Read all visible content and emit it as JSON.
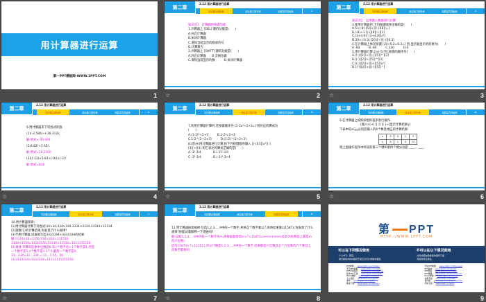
{
  "colors": {
    "accent": "#1ea0e6",
    "highlight": "#ffd400",
    "answer": "#e020e0",
    "logo_blue": "#1d4d8a",
    "logo_orange": "#f07a1a"
  },
  "header": {
    "chapter": "第二章",
    "section": "2.12  用计算器进行运算",
    "tabs": [
      "知识要点基础练",
      "综合能力提升练",
      "拓展探究突破练"
    ]
  },
  "slides": [
    {
      "number": "1",
      "type": "title",
      "title": "用计算器进行运算",
      "subtitle": "第一PPT模板网-WWW.1PPT.COM"
    },
    {
      "number": "2",
      "type": "content",
      "active_tab": 0,
      "page": "-2-",
      "lines": [
        {
          "t": "知识点1　计算器的按键功能",
          "c": "pink"
        },
        {
          "t": "1.计算器上 [DEL] 键的功能是(　　)"
        },
        {
          "t": "A.开启计算器"
        },
        {
          "t": "B.关闭计算器"
        },
        {
          "t": "C.清除当前显示的数或符号"
        },
        {
          "t": "D.计算乘方"
        },
        {
          "t": "2.计算器上 [SHIFT] 键的功能是(　　)"
        },
        {
          "t": "A.开启计算器　　B.交换功能"
        },
        {
          "t": "C.清除当前显示的数　　　D.关闭计算器"
        }
      ]
    },
    {
      "number": "3",
      "type": "content",
      "active_tab": 0,
      "page": "-3-",
      "lines": [
        {
          "t": "知识点2　运用输入数据进行计算",
          "c": "pink"
        },
        {
          "t": "3.使用计算器时,下列按键顺序正确的是(　　)"
        },
        {
          "t": "A.5×(-8) [5][×][(-)][8][=]"
        },
        {
          "t": "B.(-8)÷3 [(-)][8][÷][3]"
        },
        {
          "t": "C.(3+4.9)² [3+4.9][x²]"
        },
        {
          "t": "D.20÷(-0.3) [20][÷][(-)][0.3]"
        },
        {
          "t": "4.在计算器上依次按键 [20÷0.2=0.3=] 后,显示器显示的结果为(　　)"
        },
        {
          "t": "A.-60　　　B.-80　　　C.120　　　D.0"
        },
        {
          "t": "5.用计算器计算-2×(-5)³时,按键的顺序为(　　)"
        },
        {
          "t": "A.[(-)][2][×][(-)][5][^][3]"
        },
        {
          "t": "B.[(-)][2][×][5][^][3]"
        },
        {
          "t": "C.[(-)][2][×][(-)][5][x³]"
        },
        {
          "t": "D.[(-)][2][×][(-)][5][^]"
        }
      ]
    },
    {
      "number": "4",
      "type": "content",
      "active_tab": 0,
      "page": "-4-",
      "lines": [
        {
          "t": "6.用计算器求下列各式的值:"
        },
        {
          "t": "(1)(-2.586)÷(-28.313);"
        },
        {
          "t": "解:原式≈-30.009",
          "c": "pink"
        },
        {
          "t": "(2)4.82³÷2.45²;"
        },
        {
          "t": "解:原式≈19.2360",
          "c": "pink"
        },
        {
          "t": "(3)[(-12)×5-81÷(-9)]×(-2)³."
        },
        {
          "t": "解:原式=816",
          "c": "pink"
        }
      ]
    },
    {
      "number": "5",
      "type": "content",
      "active_tab": 1,
      "page": "-5-",
      "lines": [
        {
          "t": "7.利用计算器计算时,若按键顺序为 [1-2x²÷2+3=] 则对应的算式为"
        },
        {
          "t": "(　　)"
        },
        {
          "t": "A.(1-2)²÷2+3　　　B.1-2²÷2+3"
        },
        {
          "t": "C.1-2^(2÷2+3)　　　D.(1-2)^(2÷2+3)"
        },
        {
          "t": "8.(贵州)用计算器进行计算,按下列按键顺序输入 [(-)][3][x²][-]"
        },
        {
          "t": "[3][÷][4] 则它表达的算式正确的是(　　)"
        },
        {
          "t": "A.-3²-3/4　　　　B.(-3)²-3/4"
        },
        {
          "t": "C.-3⁵-3/4　　　　D.(-3)²-3÷4"
        }
      ]
    },
    {
      "number": "6",
      "type": "content",
      "active_tab": 1,
      "page": "-6-",
      "lines": [
        {
          "t": "9.在计算器上按照如图的程序进行操作:"
        },
        {
          "t": "　　　　　　　[输入x]→[ ][ ][ ][ ]→[显示计算结果y]"
        },
        {
          "t": "下表中的x与y分别是输入的6个数及相应的计算结果:"
        },
        {
          "t": "则上面操作程序中所按的第三个键和第四个键分别是 ____、____."
        }
      ],
      "table": {
        "x_label": "x",
        "y_label": "y",
        "x": [
          "-2",
          "0",
          "1",
          "3"
        ],
        "y": [
          "-5",
          "1",
          "4",
          "10"
        ]
      }
    },
    {
      "number": "7",
      "type": "content",
      "active_tab": 1,
      "page": "-7-",
      "lines": [
        {
          "t": "10.用计算器探索:"
        },
        {
          "t": "(1)用计算器计算下列各式:34×34,334×334,3334×3334,33334×33334."
        },
        {
          "t": "(2)观察(1)的计算结果,你发现了什么规律?"
        },
        {
          "t": "(3)不用计算器,试直接写出3333334×3333334的结果."
        },
        {
          "t": " "
        },
        {
          "t": "解:(1)34×34=1156,334×334=111556,",
          "c": "pink"
        },
        {
          "t": "3334×3334=11115556,33334×33334=1111155556.",
          "c": "pink"
        },
        {
          "t": "(2)规律:计算的结果中位数是8,其n个数字有n-1个数字是1,然后",
          "c": "pink"
        },
        {
          "t": "一个数字是5,n个数字是n-1个5,最后一个数字是6.",
          "c": "pink"
        },
        {
          "t": "33…334×33…334 = 11…1 55…56",
          "c": "pink"
        },
        {
          "t": "(3)3333334×3333334=11111115555556.",
          "c": "pink"
        }
      ]
    },
    {
      "number": "8",
      "type": "content",
      "active_tab": 2,
      "page": "-8-",
      "lines": [
        {
          "t": "11.用计算器探索规律:任选1,2,3,…,9中的一个数字,并将这个数字乘以7,再将结果乘以15873,你发现了什么规律?你能试着解释一下理由吗?",
          "w": true
        },
        {
          "t": " "
        },
        {
          "t": " "
        },
        {
          "t": "解:设取1,2,3,…,9中的任一个数字为m,则根据题意得m×7×15873=mmmmmm(此处为各数位上都是m的六位数).",
          "c": "pink",
          "w": true
        },
        {
          "t": "因为15873×7=111111,所以只要是1,2,3,…,9中任一个数字,结果都是六位数且这个六位数的六个数位上的数字都相同.",
          "c": "pink",
          "w": true
        }
      ]
    },
    {
      "number": "9",
      "type": "ad",
      "logo": "第一PPT",
      "url": "HTTP://WWW.1PPT.COM",
      "can_title": "可以在下列情况使用",
      "can_items": [
        "·个人学习、研究。",
        "·拷贝模板中的内容用于其它幻灯片母版中使用。"
      ],
      "cannot_title": "不可以在以下情况使用",
      "cannot_items": [
        "·出售或更改模板使用权限下载。",
        "·用途用商业用途。"
      ],
      "links_left": [
        [
          "PPT模板:",
          "www.1ppt.com/moban/"
        ],
        [
          "节日PPT模板:",
          "www.1ppt.com/jieri/"
        ],
        [
          "PPT背景图片:",
          "www.1ppt.com/beijing/"
        ],
        [
          "优秀PPT下载:",
          "www.1ppt.com/xiazai/"
        ],
        [
          "Word教程:",
          "www.1ppt.com/word/"
        ],
        [
          "个人简历:",
          "www.1ppt.com/jianli/"
        ],
        [
          "课件:",
          "www.1ppt.com/kejian/"
        ],
        [
          "教案下载:",
          "www.1ppt.com/jiaoan/"
        ]
      ],
      "links_right": [
        [
          "行业PPT模板:",
          "www.1ppt.com/hangye/"
        ],
        [
          "PPT素材:",
          "www.1ppt.com/sucai/"
        ],
        [
          "PPT图表:",
          "www.1ppt.com/tubiao/"
        ],
        [
          "PPT教程:",
          "www.1ppt.com/powerpoint/"
        ],
        [
          "Excel教程:",
          "www.1ppt.com/excel/"
        ],
        [
          "试卷下载:",
          "www.1ppt.com/shiti/"
        ],
        [
          "手抄报:",
          "www.1ppt.com/shouchaobao/"
        ],
        [
          "字体下载:",
          "www.1ppt.com/ziti/"
        ]
      ]
    }
  ]
}
